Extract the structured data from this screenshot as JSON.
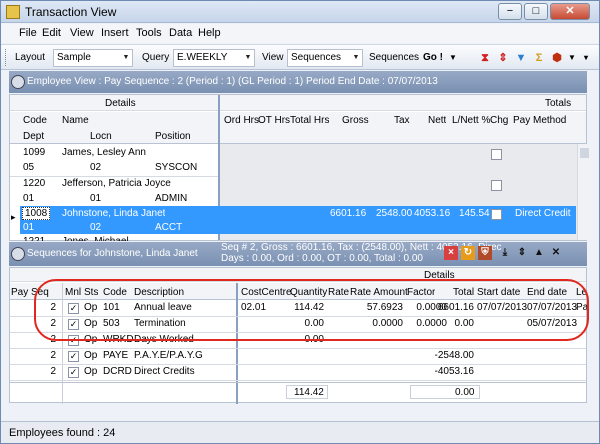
{
  "window": {
    "title": "Transaction View",
    "min_label": "−",
    "max_label": "□",
    "close_label": "✕"
  },
  "menu": [
    "File",
    "Edit",
    "View",
    "Insert",
    "Tools",
    "Data",
    "Help"
  ],
  "toolbar": {
    "layout_label": "Layout",
    "layout_value": "Sample",
    "query_label": "Query",
    "query_value": "E.WEEKLY",
    "view_label": "View",
    "view_value": "Sequences",
    "sequences_label": "Sequences",
    "go_label": "Go !"
  },
  "employee_panel": {
    "header": "Employee View : Pay Sequence : 2 (Period : 1) (GL Period : 1) Period End Date : 07/07/2013",
    "group_details": "Details",
    "group_totals": "Totals",
    "columns_top": [
      "Code",
      "Name"
    ],
    "columns_bottom": [
      "Dept",
      "Locn",
      "Position"
    ],
    "columns_right": [
      "Ord Hrs",
      "OT Hrs",
      "Total Hrs",
      "Gross",
      "Tax",
      "Nett",
      "L/Nett %",
      "Chg",
      "Pay Method"
    ],
    "rows": [
      {
        "code": "1099",
        "name": "James, Lesley Ann",
        "dept": "05",
        "locn": "02",
        "position": "SYSCON",
        "gross": "",
        "tax": "",
        "nett": "",
        "lnett": "",
        "pay_method": ""
      },
      {
        "code": "1220",
        "name": "Jefferson, Patricia Joyce",
        "dept": "01",
        "locn": "01",
        "position": "ADMIN",
        "gross": "",
        "tax": "",
        "nett": "",
        "lnett": "",
        "pay_method": ""
      },
      {
        "code": "1008",
        "name": "Johnstone, Linda Janet",
        "dept": "01",
        "locn": "02",
        "position": "ACCT",
        "gross": "6601.16",
        "tax": "2548.00",
        "nett": "4053.16",
        "lnett": "145.54",
        "pay_method": "Direct Credit"
      },
      {
        "code": "1221",
        "name": "Jones, Michael",
        "dept": "",
        "locn": "",
        "position": "",
        "gross": "",
        "tax": "",
        "nett": "",
        "lnett": "",
        "pay_method": ""
      }
    ]
  },
  "sequences_panel": {
    "header_left": "Sequences for Johnstone, Linda Janet",
    "header_info_1": "Seq # 2, Gross : 6601.16, Tax : (2548.00), Nett : 4053.16, Direc",
    "header_info_2": "Days : 0.00, Ord : 0.00, OT : 0.00, Total : 0.00",
    "group_details": "Details",
    "pay_seq_label": "Pay Seq",
    "columns": [
      "",
      "Mnl",
      "Sts",
      "Code",
      "Description",
      "CostCentre",
      "Quantity",
      "Rate",
      "Rate Amount",
      "Factor",
      "Total",
      "Start date",
      "End date",
      "Le"
    ],
    "rows": [
      {
        "seq": "2",
        "sts": "Op",
        "code": "101",
        "desc": "Annual leave",
        "cc": "02.01",
        "qty": "114.42",
        "rate": "",
        "rate_amt": "57.6923",
        "factor": "0.0000",
        "total": "6601.16",
        "start": "07/07/2013",
        "end": "07/07/2013",
        "le": "Pa"
      },
      {
        "seq": "2",
        "sts": "Op",
        "code": "503",
        "desc": "Termination",
        "cc": "",
        "qty": "0.00",
        "rate": "",
        "rate_amt": "0.0000",
        "factor": "0.0000",
        "total": "0.00",
        "start": "",
        "end": "05/07/2013",
        "le": ""
      },
      {
        "seq": "2",
        "sts": "Op",
        "code": "WRKD",
        "desc": "Days Worked",
        "cc": "",
        "qty": "0.00",
        "rate": "",
        "rate_amt": "",
        "factor": "",
        "total": "",
        "start": "",
        "end": "",
        "le": ""
      },
      {
        "seq": "2",
        "sts": "Op",
        "code": "PAYE",
        "desc": "P.A.Y.E/P.A.Y.G",
        "cc": "",
        "qty": "",
        "rate": "",
        "rate_amt": "",
        "factor": "",
        "total": "-2548.00",
        "start": "",
        "end": "",
        "le": ""
      },
      {
        "seq": "2",
        "sts": "Op",
        "code": "DCRD",
        "desc": "Direct Credits",
        "cc": "",
        "qty": "",
        "rate": "",
        "rate_amt": "",
        "factor": "",
        "total": "-4053.16",
        "start": "",
        "end": "",
        "le": ""
      }
    ],
    "footer_qty": "114.42",
    "footer_total": "0.00"
  },
  "status": "Employees found : 24",
  "highlight_color": "#e0281e",
  "selection_color": "#3399ff"
}
